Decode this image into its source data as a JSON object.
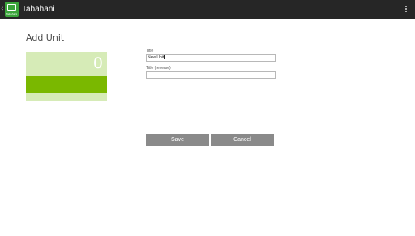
{
  "app": {
    "title": "Tabahani",
    "icon_tag": "Tabahani"
  },
  "page": {
    "title": "Add Unit"
  },
  "preview": {
    "count": "0"
  },
  "form": {
    "title_label": "Title",
    "title_value": "New Unit",
    "title_reverse_label": "Title (reverse)",
    "title_reverse_value": "",
    "save_label": "Save",
    "cancel_label": "Cancel"
  },
  "colors": {
    "actionbar": "#262626",
    "preview_bg": "#d6ebb7",
    "preview_band": "#7ab800",
    "button": "#8a8a8a"
  }
}
